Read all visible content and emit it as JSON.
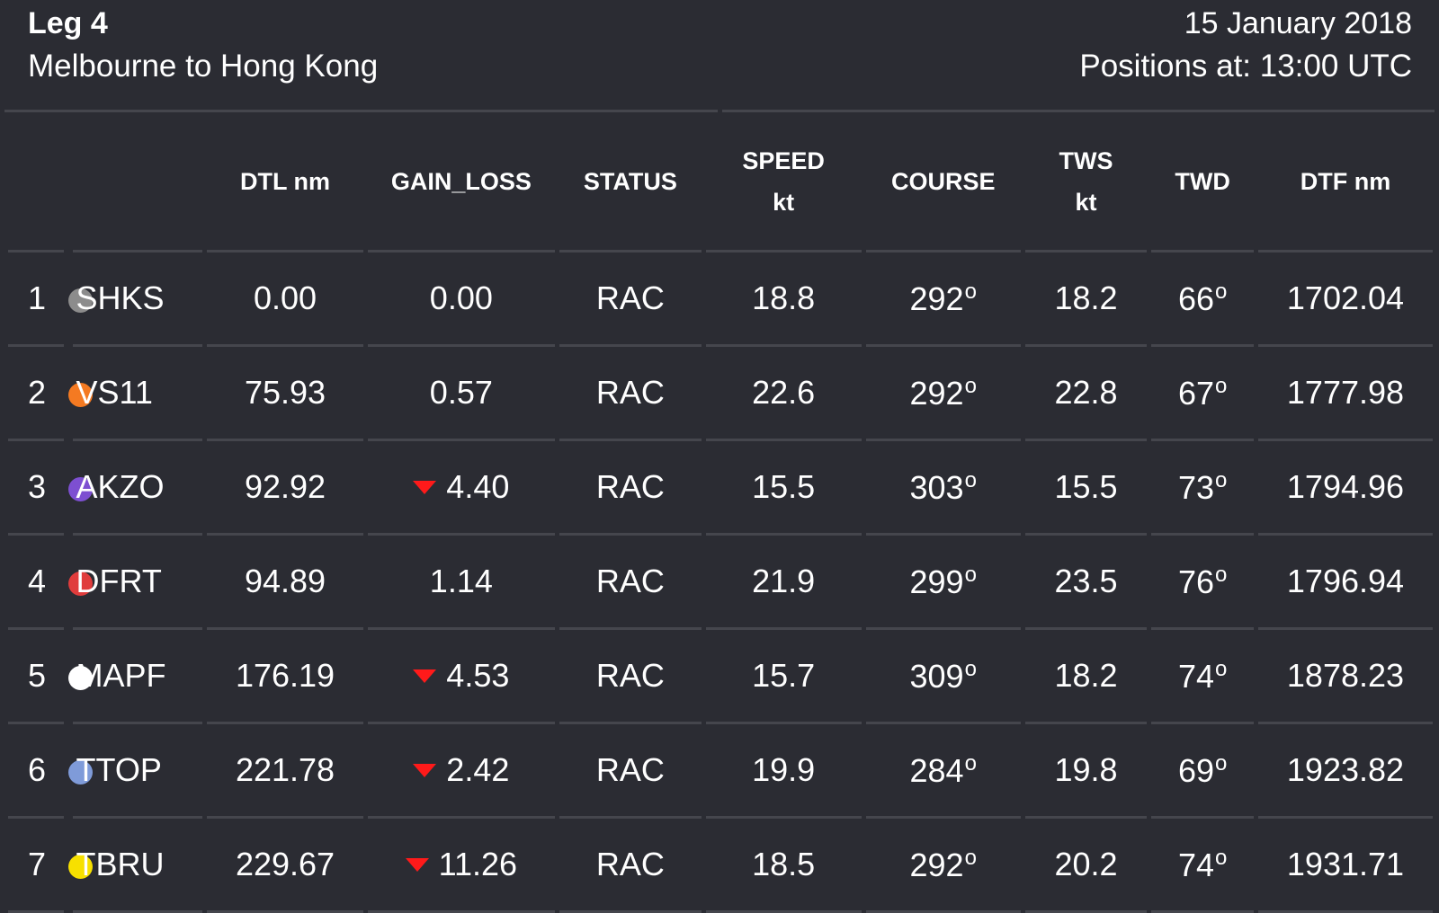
{
  "header": {
    "leg": "Leg 4",
    "route": "Melbourne to Hong Kong",
    "date": "15 January 2018",
    "positions": "Positions at: 13:00 UTC"
  },
  "columns": {
    "dtl": "DTL nm",
    "gain_loss": "GAIN_LOSS",
    "status": "STATUS",
    "speed_1": "SPEED",
    "speed_2": "kt",
    "course": "COURSE",
    "tws_1": "TWS",
    "tws_2": "kt",
    "twd": "TWD",
    "dtf": "DTF nm"
  },
  "rows": [
    {
      "rank": "1",
      "team": "SHKS",
      "color": "#8c8c8c",
      "dtl": "0.00",
      "gain_loss": "0.00",
      "loss": false,
      "status": "RAC",
      "speed": "18.8",
      "course": "292",
      "tws": "18.2",
      "twd": "66",
      "dtf": "1702.04"
    },
    {
      "rank": "2",
      "team": "VS11",
      "color": "#f47a22",
      "dtl": "75.93",
      "gain_loss": "0.57",
      "loss": false,
      "status": "RAC",
      "speed": "22.6",
      "course": "292",
      "tws": "22.8",
      "twd": "67",
      "dtf": "1777.98"
    },
    {
      "rank": "3",
      "team": "AKZO",
      "color": "#7d4fd1",
      "dtl": "92.92",
      "gain_loss": "4.40",
      "loss": true,
      "status": "RAC",
      "speed": "15.5",
      "course": "303",
      "tws": "15.5",
      "twd": "73",
      "dtf": "1794.96"
    },
    {
      "rank": "4",
      "team": "DFRT",
      "color": "#e03c3c",
      "dtl": "94.89",
      "gain_loss": "1.14",
      "loss": false,
      "status": "RAC",
      "speed": "21.9",
      "course": "299",
      "tws": "23.5",
      "twd": "76",
      "dtf": "1796.94"
    },
    {
      "rank": "5",
      "team": "MAPF",
      "color": "#ffffff",
      "dtl": "176.19",
      "gain_loss": "4.53",
      "loss": true,
      "status": "RAC",
      "speed": "15.7",
      "course": "309",
      "tws": "18.2",
      "twd": "74",
      "dtf": "1878.23"
    },
    {
      "rank": "6",
      "team": "TTOP",
      "color": "#7f9bd9",
      "dtl": "221.78",
      "gain_loss": "2.42",
      "loss": true,
      "status": "RAC",
      "speed": "19.9",
      "course": "284",
      "tws": "19.8",
      "twd": "69",
      "dtf": "1923.82"
    },
    {
      "rank": "7",
      "team": "TBRU",
      "color": "#f7e000",
      "dtl": "229.67",
      "gain_loss": "11.26",
      "loss": true,
      "status": "RAC",
      "speed": "18.5",
      "course": "292",
      "tws": "20.2",
      "twd": "74",
      "dtf": "1931.71"
    }
  ],
  "degree_symbol": "o"
}
